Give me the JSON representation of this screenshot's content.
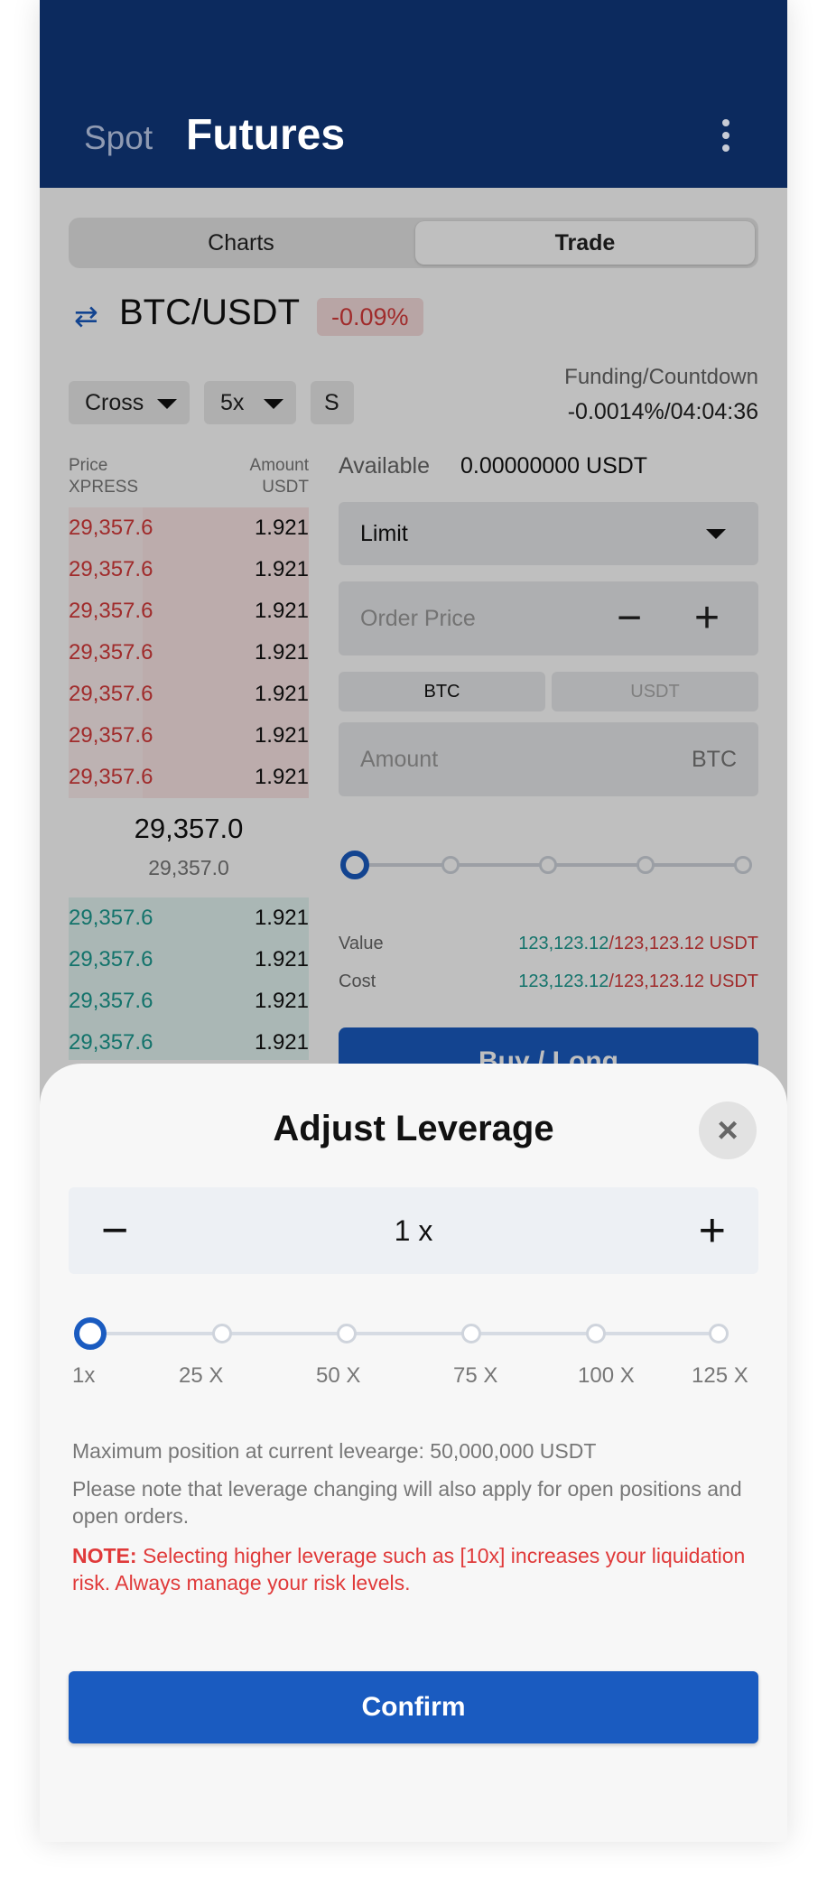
{
  "header": {
    "tab_spot": "Spot",
    "tab_futures": "Futures"
  },
  "segment": {
    "charts": "Charts",
    "trade": "Trade"
  },
  "pair": {
    "name": "BTC/USDT",
    "change": "-0.09%"
  },
  "controls": {
    "margin_mode": "Cross",
    "leverage": "5x",
    "s_button": "S"
  },
  "funding": {
    "label": "Funding/Countdown",
    "value": "-0.0014%/04:04:36"
  },
  "orderbook": {
    "price_header": "Price",
    "price_sub": "XPRESS",
    "amount_header": "Amount",
    "amount_sub": "USDT",
    "asks": [
      {
        "price": "29,357.6",
        "amount": "1.921"
      },
      {
        "price": "29,357.6",
        "amount": "1.921"
      },
      {
        "price": "29,357.6",
        "amount": "1.921"
      },
      {
        "price": "29,357.6",
        "amount": "1.921"
      },
      {
        "price": "29,357.6",
        "amount": "1.921"
      },
      {
        "price": "29,357.6",
        "amount": "1.921"
      },
      {
        "price": "29,357.6",
        "amount": "1.921"
      }
    ],
    "mid_price": "29,357.0",
    "mark_price": "29,357.0",
    "bids": [
      {
        "price": "29,357.6",
        "amount": "1.921"
      },
      {
        "price": "29,357.6",
        "amount": "1.921"
      },
      {
        "price": "29,357.6",
        "amount": "1.921"
      },
      {
        "price": "29,357.6",
        "amount": "1.921"
      }
    ]
  },
  "order_form": {
    "available_label": "Available",
    "available_value": "0.00000000 USDT",
    "order_type": "Limit",
    "order_price_placeholder": "Order Price",
    "unit_btc": "BTC",
    "unit_usdt": "USDT",
    "amount_placeholder": "Amount",
    "amount_unit": "BTC",
    "value_label": "Value",
    "value_green": "123,123.12",
    "value_red": "/123,123.12 USDT",
    "cost_label": "Cost",
    "cost_green": "123,123.12",
    "cost_red": "/123,123.12 USDT",
    "buy_label": "Buy / Long"
  },
  "modal": {
    "title": "Adjust Leverage",
    "value": "1 x",
    "current_leverage_fraction": 0,
    "marks": [
      "1x",
      "25 X",
      "50 X",
      "75 X",
      "100 X",
      "125 X"
    ],
    "max_position": "Maximum position at current levearge: 50,000,000 USDT",
    "warning": "Please note that leverage changing will also apply for open positions and open orders.",
    "note_label": "NOTE:",
    "note_text": " Selecting higher leverage such as [10x] increases your liquidation risk. Always manage your risk levels.",
    "confirm": "Confirm"
  },
  "colors": {
    "brand_blue": "#1a5bc0",
    "header_navy": "#0c2a5e",
    "sell_red": "#d63a3a",
    "buy_teal": "#1a9a8f"
  }
}
